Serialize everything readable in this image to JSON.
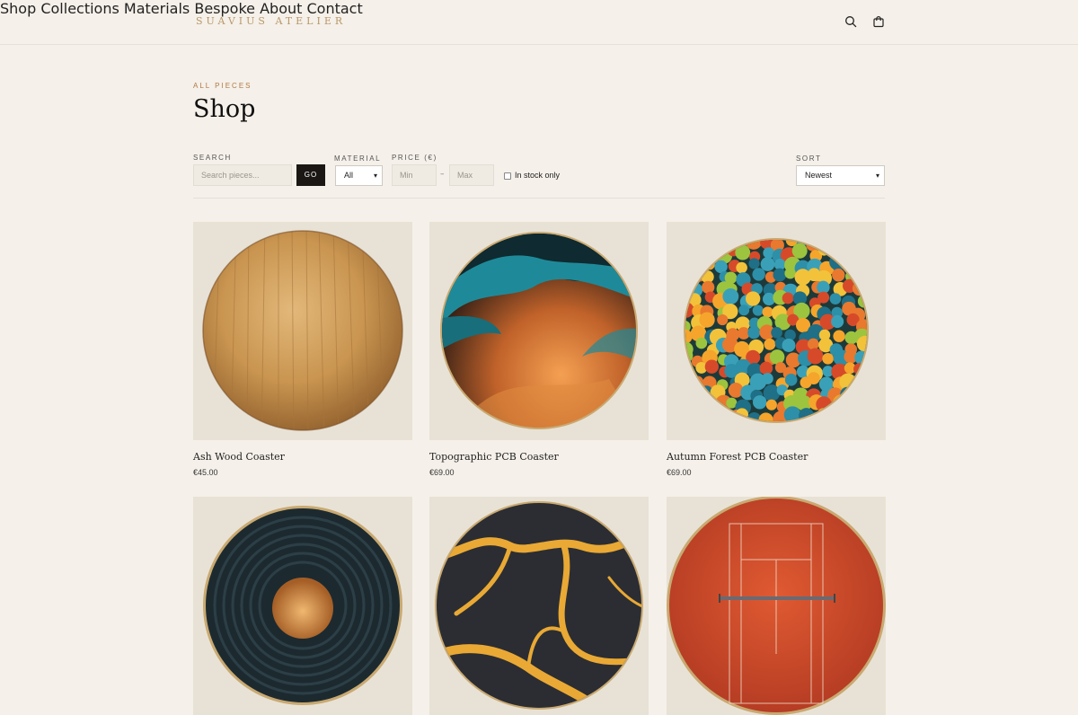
{
  "brand": "SUAVIUS ATELIER",
  "nav": [
    "Shop",
    "Collections",
    "Materials",
    "Bespoke",
    "About",
    "Contact"
  ],
  "header_icons": [
    "search-icon",
    "cart-icon"
  ],
  "eyebrow": "ALL PIECES",
  "title": "Shop",
  "filters": {
    "search_label": "SEARCH",
    "search_placeholder": "Search pieces...",
    "go_label": "GO",
    "material_label": "MATERIAL",
    "material_value": "All",
    "price_label": "PRICE (€)",
    "min_placeholder": "Min",
    "max_placeholder": "Max",
    "price_separator": "–",
    "instock_label": "In stock only",
    "sort_label": "SORT",
    "sort_value": "Newest"
  },
  "products": [
    {
      "name": "Ash Wood Coaster",
      "price": "€45.00"
    },
    {
      "name": "Topographic PCB Coaster",
      "price": "€69.00"
    },
    {
      "name": "Autumn Forest PCB Coaster",
      "price": "€69.00"
    },
    {
      "name": "",
      "price": ""
    },
    {
      "name": "",
      "price": ""
    },
    {
      "name": "",
      "price": ""
    }
  ],
  "colors": {
    "background": "#f5f0e9",
    "brand": "#b8986a",
    "eyebrow": "#b07a46",
    "button": "#1a1714",
    "card": "#e8e2d6"
  }
}
